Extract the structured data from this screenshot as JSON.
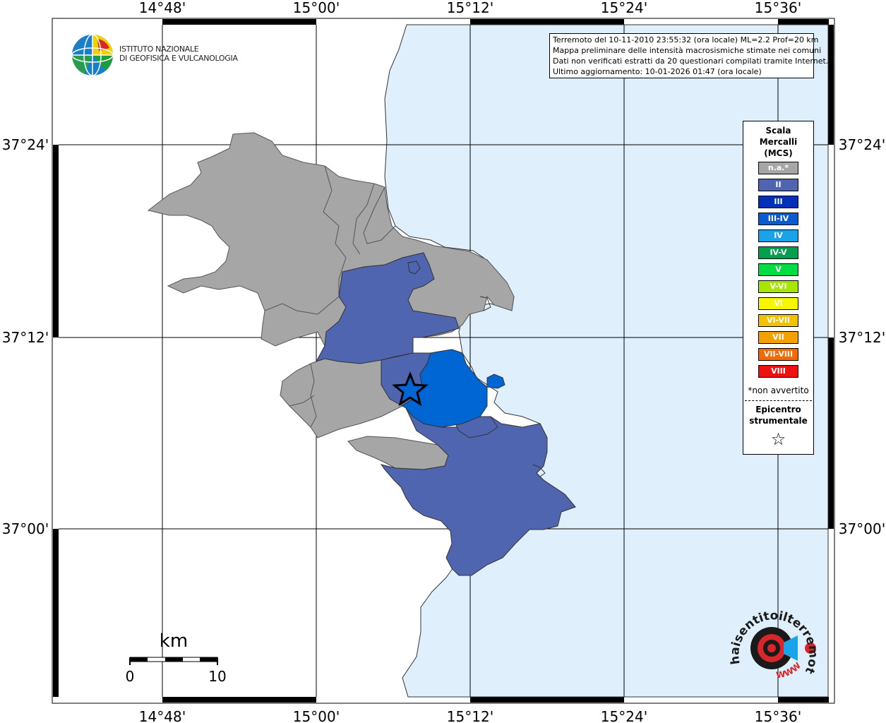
{
  "map": {
    "lon_labels": [
      "14°48'",
      "15°00'",
      "15°12'",
      "15°24'",
      "15°36'"
    ],
    "lat_labels": [
      "37°24'",
      "37°12'",
      "37°00'"
    ],
    "scale_bar": {
      "unit": "km",
      "min_label": "0",
      "max_label": "10"
    },
    "colors": {
      "land": "#ffffff",
      "sea": "#dff0fc",
      "grid": "#000000",
      "na": "#a6a6a6",
      "ii": "#5065b0",
      "iv": "#0066d4"
    }
  },
  "logo": {
    "line1": "ISTITUTO NAZIONALE",
    "line2": "DI GEOFISICA E VULCANOLOGIA",
    "site": "haisentitoilterremoto.it",
    "site_www": "WWW"
  },
  "info_box": {
    "lines": [
      "Terremoto del 10-11-2010 23:55:32 (ora locale) ML=2.2 Prof=20 km",
      "Mappa preliminare delle intensità macrosismiche stimate nei comuni",
      "Dati non verificati estratti da 20 questionari compilati tramite Internet.",
      "Ultimo aggiornamento: 10-01-2026 01:47 (ora locale)"
    ]
  },
  "legend": {
    "title_lines": [
      "Scala",
      "Mercalli",
      "(MCS)"
    ],
    "items": [
      {
        "label": "n.a.*",
        "color": "#a6a6a6"
      },
      {
        "label": "II",
        "color": "#5065b0"
      },
      {
        "label": "III",
        "color": "#0030b8"
      },
      {
        "label": "III-IV",
        "color": "#0a5ad0"
      },
      {
        "label": "IV",
        "color": "#1aa3e8"
      },
      {
        "label": "IV-V",
        "color": "#00a050"
      },
      {
        "label": "V",
        "color": "#00dd44"
      },
      {
        "label": "V-VI",
        "color": "#a6e600"
      },
      {
        "label": "VI",
        "color": "#f6f600"
      },
      {
        "label": "VI-VII",
        "color": "#f2c200"
      },
      {
        "label": "VII",
        "color": "#f4a000"
      },
      {
        "label": "VII-VIII",
        "color": "#f56a00"
      },
      {
        "label": "VIII",
        "color": "#ee1111"
      }
    ],
    "note": "*non avvertito",
    "epicentre_lines": [
      "Epicentro",
      "strumentale"
    ],
    "epicentre_symbol": "☆"
  }
}
